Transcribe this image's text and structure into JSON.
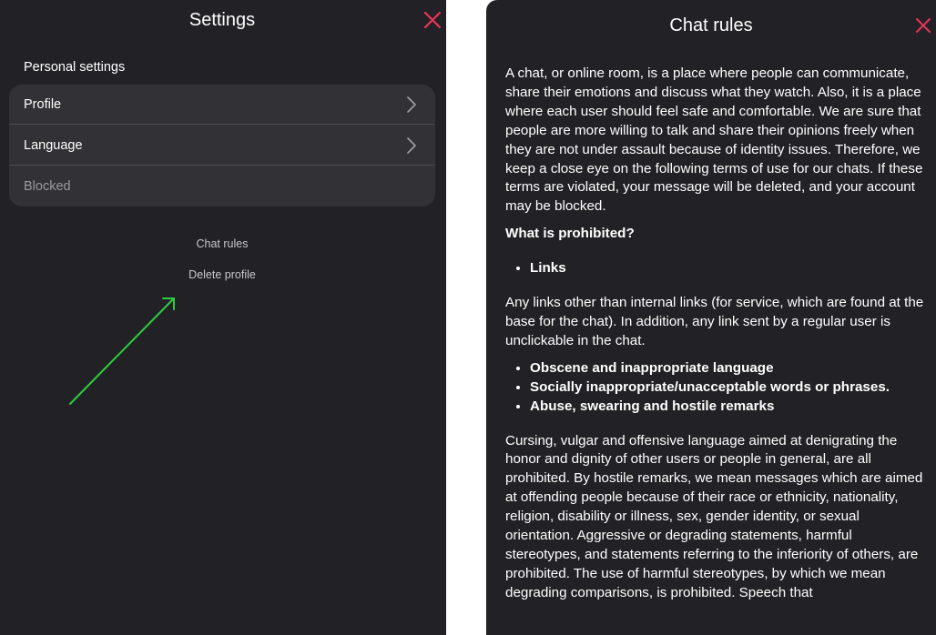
{
  "settings": {
    "title": "Settings",
    "section_label": "Personal settings",
    "items": [
      {
        "label": "Profile",
        "icon": "chevron-right-icon",
        "enabled": true
      },
      {
        "label": "Language",
        "icon": "chevron-right-icon",
        "enabled": true
      },
      {
        "label": "Blocked",
        "enabled": false
      }
    ],
    "links": {
      "chat_rules": "Chat rules",
      "delete_profile": "Delete profile"
    },
    "close_icon": "close-icon"
  },
  "chat_rules": {
    "title": "Chat rules",
    "intro": "A chat, or online room, is a place where people can communicate, share their emotions and discuss what they watch. Also, it is a place where each user should feel safe and comfortable. We are sure that people are more willing to talk and share their opinions freely when they are not under assault because of identity issues. Therefore, we keep a close eye on the following terms of use for our chats. If these terms are violated, your message will be deleted, and your account may be blocked.",
    "prohibited_heading": "What is prohibited?",
    "list_1": [
      "Links"
    ],
    "links_paragraph": "Any links other than internal links (for service, which are found at the base for the chat). In addition, any link sent by a regular user is unclickable in the chat.",
    "list_2": [
      "Obscene and inappropriate language",
      "Socially inappropriate/unacceptable words or phrases.",
      "Abuse, swearing and hostile remarks"
    ],
    "language_paragraph": "Cursing, vulgar and offensive language aimed at denigrating the honor and dignity of other users or people in general, are all prohibited. By hostile remarks, we mean messages which are aimed at offending people because of their race or ethnicity, nationality, religion, disability or illness, sex, gender identity, or sexual orientation. Aggressive or degrading statements, harmful stereotypes, and statements referring to the inferiority of others, are prohibited. The use of harmful stereotypes, by which we mean degrading comparisons, is prohibited. Speech that",
    "close_icon": "close-icon"
  },
  "colors": {
    "panel_background": "#222226",
    "card_background": "#323236",
    "close_accent": "#e8345a",
    "annotation_arrow": "#2ecc40",
    "disabled_text": "#9a9aa0"
  }
}
